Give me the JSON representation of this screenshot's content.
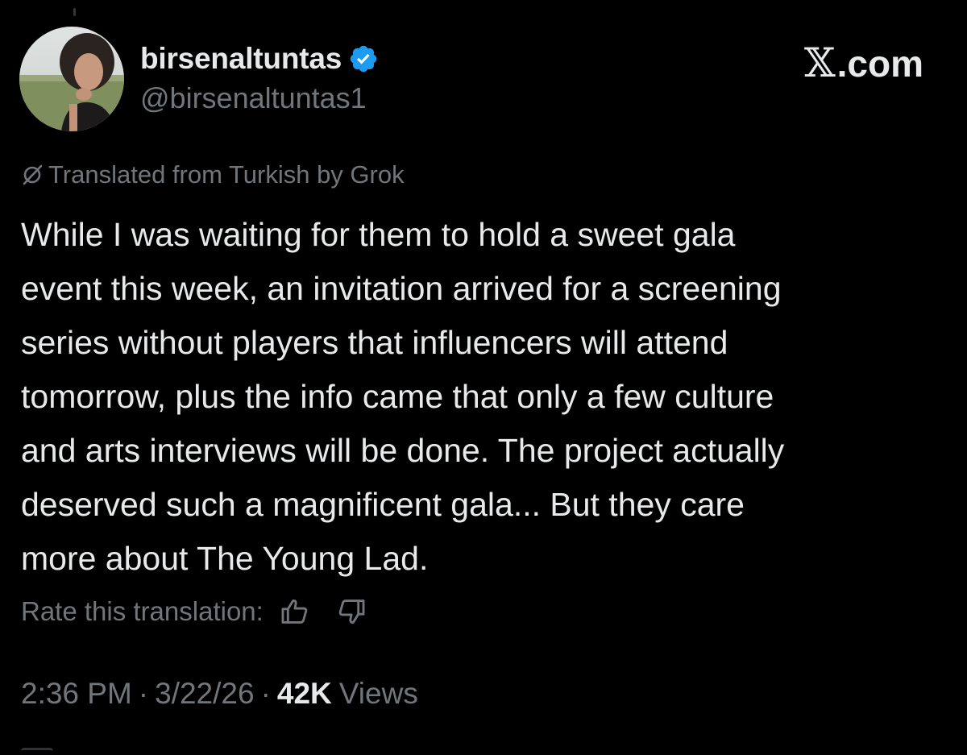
{
  "site": {
    "logo_text": ".com"
  },
  "author": {
    "display_name": "birsenaltuntas",
    "handle": "@birsenaltuntas1",
    "verified": true,
    "verified_color": "#1d9bf0"
  },
  "translation": {
    "notice": "Translated from Turkish by Grok"
  },
  "tweet": {
    "text": "While I was waiting for them to hold a sweet gala\nevent this week, an invitation arrived for a screening\nseries without players that influencers will attend\ntomorrow, plus the info came that only a few culture\nand arts interviews will be done. The project actually\ndeserved such a magnificent gala... But they care\nmore about The Young Lad."
  },
  "rating": {
    "label": "Rate this translation:",
    "up_icon": "thumbs-up-icon",
    "down_icon": "thumbs-down-icon"
  },
  "meta": {
    "time": "2:36 PM",
    "separator": "·",
    "date": "3/22/26",
    "views_count": "42K",
    "views_label": "Views"
  },
  "colors": {
    "background": "#000000",
    "primary_text": "#e7e9ea",
    "secondary_text": "#71767b",
    "accent": "#1d9bf0"
  }
}
